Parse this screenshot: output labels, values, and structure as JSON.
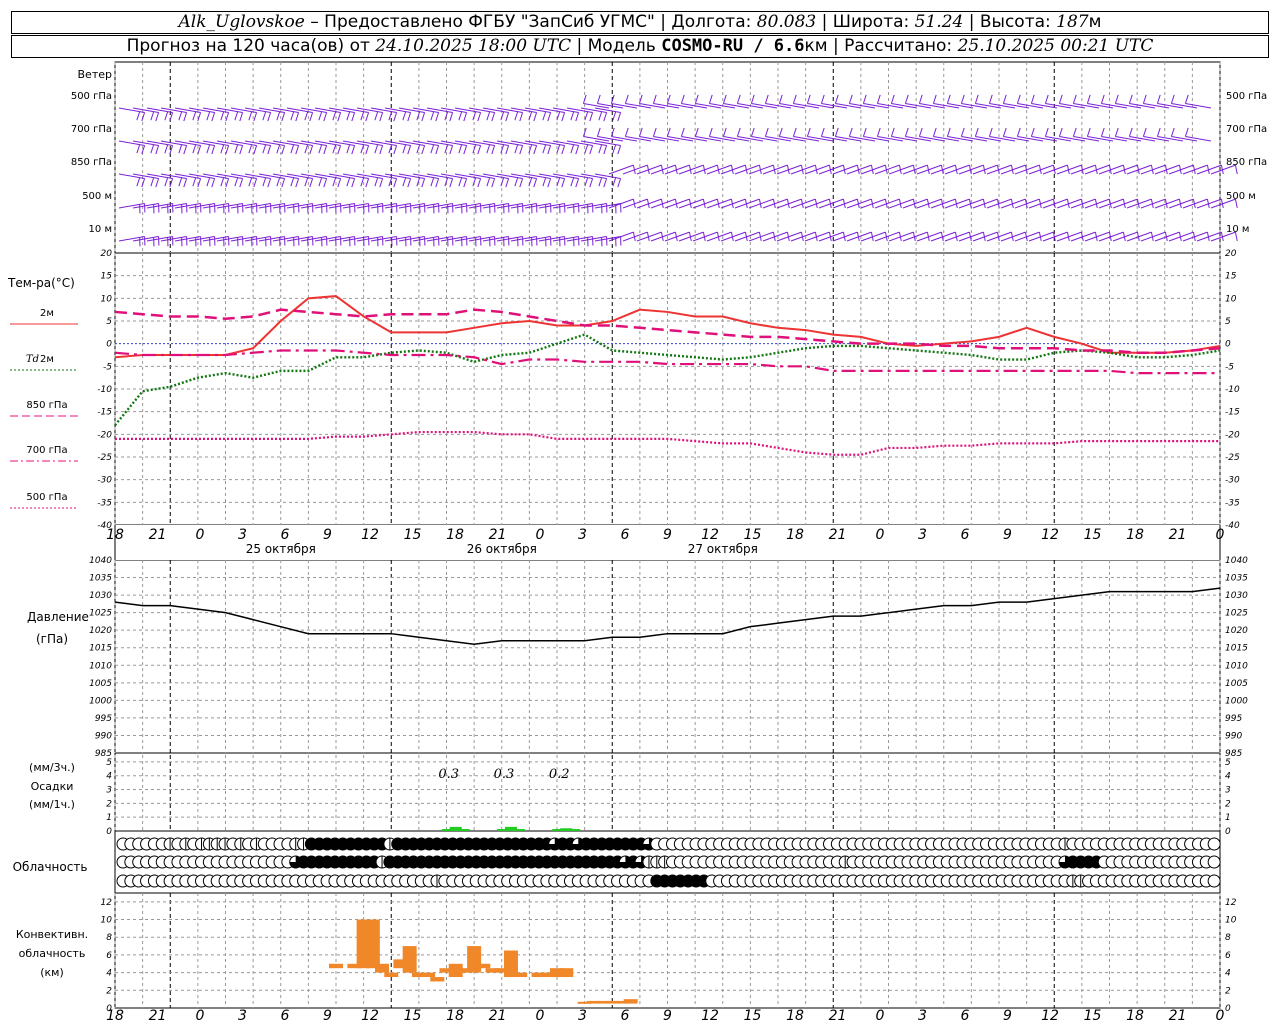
{
  "header": {
    "station": "Alk_Uglovskoe",
    "dash": " – ",
    "provider": "Предоставлено ФГБУ \"ЗапСиб УГМС\"",
    "sep": " | ",
    "lon_label": "Долгота: ",
    "lon_value": "80.083",
    "lat_label": "Широта: ",
    "lat_value": "51.24",
    "alt_label": "Высота: ",
    "alt_value": "187",
    "alt_unit": "м",
    "forecast_prefix": "Прогноз на 120 часа(ов) от ",
    "forecast_time": "24.10.2025 18:00 UTC",
    "model_label": " | Модель ",
    "model_name": "COSMO-RU / 6.6",
    "model_unit": "км",
    "calc_label": " | Рассчитано: ",
    "calc_time": "25.10.2025 00:21 UTC"
  },
  "x_axis": {
    "hour_labels": [
      "18",
      "21",
      "0",
      "3",
      "6",
      "9",
      "12",
      "15",
      "18",
      "21",
      "0",
      "3",
      "6",
      "9",
      "12",
      "15",
      "18",
      "21",
      "0",
      "3",
      "6",
      "9",
      "12",
      "15",
      "18",
      "21",
      "0"
    ],
    "day_labels": [
      "25 октября",
      "26 октября",
      "27 октября"
    ]
  },
  "wind_panel": {
    "title": "Ветер",
    "levels": [
      "500 гПа",
      "700 гПа",
      "850 гПа",
      "500 м",
      "10  м"
    ],
    "color": "#7b1fd6"
  },
  "temp_panel": {
    "title": "Тем-ра(°С)",
    "y_ticks": [
      "20",
      "15",
      "10",
      "5",
      "0",
      "-5",
      "-10",
      "-15",
      "-20",
      "-25",
      "-30",
      "-35",
      "-40"
    ],
    "legend": [
      {
        "label": "2м",
        "color": "#ee3333",
        "style": "solid"
      },
      {
        "label_a": "Td",
        "label_b": " 2м",
        "color": "#117711",
        "style": "dotted"
      },
      {
        "label": "850 гПа",
        "color": "#e0107a",
        "style": "dashed"
      },
      {
        "label": "700 гПа",
        "color": "#e0107a",
        "style": "dashdot"
      },
      {
        "label": "500 гПа",
        "color": "#e0107a",
        "style": "dotted"
      }
    ]
  },
  "pressure_panel": {
    "title_a": "Давление",
    "title_b": "(гПа)",
    "y_ticks": [
      "1040",
      "1035",
      "1030",
      "1025",
      "1020",
      "1015",
      "1010",
      "1005",
      "1000",
      "995",
      "990",
      "985"
    ]
  },
  "precip_panel": {
    "title_a": "(мм/3ч.)",
    "title_b": "Осадки",
    "title_c": "(мм/1ч.)",
    "y_ticks": [
      "5",
      "4",
      "3",
      "2",
      "1",
      "0"
    ],
    "annotations": [
      "0.3",
      "0.3",
      "0.2"
    ]
  },
  "cloud_panel": {
    "title": "Облачность"
  },
  "conv_panel": {
    "title_a": "Конвективн.",
    "title_b": "облачность",
    "title_c": "(км)",
    "y_ticks": [
      "12",
      "10",
      "8",
      "6",
      "4",
      "2",
      "0"
    ]
  },
  "chart_data": [
    {
      "type": "line",
      "title": "Тем-ра(°С)",
      "ylim": [
        -40,
        20
      ],
      "x": [
        0,
        3,
        6,
        9,
        12,
        15,
        18,
        21,
        24,
        27,
        30,
        33,
        36,
        39,
        42,
        45,
        48,
        51,
        54,
        57,
        60,
        63,
        66,
        69,
        72,
        75,
        78,
        81,
        84,
        87,
        90,
        93,
        96,
        99,
        102,
        105,
        108,
        111,
        114,
        117,
        120
      ],
      "series": [
        {
          "name": "2м",
          "values": [
            -3,
            -2.5,
            -2.5,
            -2.5,
            -2.5,
            -1,
            5,
            10,
            10.5,
            6,
            2.5,
            2.5,
            2.5,
            3.5,
            4.5,
            5,
            4,
            4,
            5,
            7.5,
            7,
            6,
            6,
            4.5,
            3.5,
            3,
            2,
            1.5,
            0,
            -0.5,
            0,
            0.5,
            1.5,
            3.5,
            1.5,
            0,
            -2,
            -2,
            -2,
            -1.5,
            -0.5
          ]
        },
        {
          "name": "Td 2м",
          "values": [
            -18,
            -10.5,
            -9.5,
            -7.5,
            -6.5,
            -7.5,
            -6,
            -6,
            -3,
            -3,
            -2,
            -1.5,
            -2,
            -4,
            -2.5,
            -2,
            0,
            2,
            -1.5,
            -2,
            -2.5,
            -3,
            -3.5,
            -3,
            -2,
            -1,
            -0.5,
            -0.5,
            -1,
            -1.5,
            -2,
            -2.5,
            -3.5,
            -3.5,
            -2,
            -1.5,
            -2,
            -3,
            -3,
            -2.5,
            -1.5
          ]
        },
        {
          "name": "850 гПа",
          "values": [
            7,
            6.5,
            6,
            6,
            5.5,
            6,
            7.5,
            7,
            6.5,
            6,
            6.5,
            6.5,
            6.5,
            7.5,
            7,
            6,
            5,
            4,
            4,
            3.5,
            3,
            2.5,
            2,
            1.5,
            1.5,
            1,
            0.5,
            0,
            0,
            0,
            -0.5,
            -0.5,
            -1,
            -1,
            -1,
            -1.5,
            -1.5,
            -2,
            -2,
            -1.5,
            -1
          ]
        },
        {
          "name": "700 гПа",
          "values": [
            -2,
            -2.5,
            -2.5,
            -2.5,
            -2.5,
            -2,
            -1.5,
            -1.5,
            -1.5,
            -2,
            -2.5,
            -2.5,
            -2.5,
            -3,
            -4.5,
            -3.5,
            -3.5,
            -4,
            -4,
            -4,
            -4.5,
            -4.5,
            -4.5,
            -4.5,
            -5,
            -5,
            -6,
            -6,
            -6,
            -6,
            -6,
            -6,
            -6,
            -6,
            -6,
            -6,
            -6,
            -6.5,
            -6.5,
            -6.5,
            -6.5
          ]
        },
        {
          "name": "500 гПа",
          "values": [
            -21,
            -21,
            -21,
            -21,
            -21,
            -21,
            -21,
            -21,
            -20.5,
            -20.5,
            -20,
            -19.5,
            -19.5,
            -19.5,
            -20,
            -20,
            -21,
            -21,
            -21,
            -21,
            -21,
            -21.5,
            -22,
            -22,
            -23,
            -24,
            -24.5,
            -24.5,
            -23,
            -23,
            -22.5,
            -22.5,
            -22,
            -22,
            -22,
            -21.5,
            -21.5,
            -21.5,
            -21.5,
            -21.5,
            -21.5
          ]
        }
      ]
    },
    {
      "type": "line",
      "title": "Давление (гПа)",
      "ylim": [
        985,
        1040
      ],
      "x": [
        0,
        3,
        6,
        9,
        12,
        15,
        18,
        21,
        24,
        27,
        30,
        33,
        36,
        39,
        42,
        45,
        48,
        51,
        54,
        57,
        60,
        63,
        66,
        69,
        72,
        75,
        78,
        81,
        84,
        87,
        90,
        93,
        96,
        99,
        102,
        105,
        108,
        111,
        114,
        117,
        120
      ],
      "series": [
        {
          "name": "Давление",
          "values": [
            1028,
            1027,
            1027,
            1026,
            1025,
            1023,
            1021,
            1019,
            1019,
            1019,
            1019,
            1018,
            1017,
            1016,
            1017,
            1017,
            1017,
            1017,
            1018,
            1018,
            1019,
            1019,
            1019,
            1021,
            1022,
            1023,
            1024,
            1024,
            1025,
            1026,
            1027,
            1027,
            1028,
            1028,
            1029,
            1030,
            1031,
            1031,
            1031,
            1031,
            1032
          ]
        }
      ]
    },
    {
      "type": "bar",
      "title": "Осадки",
      "ylim": [
        0,
        5
      ],
      "x": [
        37,
        43,
        49
      ],
      "values": [
        0.3,
        0.3,
        0.2
      ],
      "values_1h": [
        0.4,
        0.4,
        0.3
      ]
    },
    {
      "type": "bar",
      "title": "Конвективн. облачность (км)",
      "ylim": [
        0,
        13
      ],
      "bars": [
        {
          "x": 24,
          "base": 4.5,
          "top": 5
        },
        {
          "x": 26,
          "base": 4.5,
          "top": 5
        },
        {
          "x": 27,
          "base": 4.5,
          "top": 10
        },
        {
          "x": 28,
          "base": 4.5,
          "top": 10
        },
        {
          "x": 29,
          "base": 4,
          "top": 5
        },
        {
          "x": 30,
          "base": 3.5,
          "top": 4
        },
        {
          "x": 31,
          "base": 4.5,
          "top": 5.5
        },
        {
          "x": 32,
          "base": 4,
          "top": 7
        },
        {
          "x": 33,
          "base": 3.5,
          "top": 4
        },
        {
          "x": 34,
          "base": 3.5,
          "top": 4
        },
        {
          "x": 35,
          "base": 3,
          "top": 3.5
        },
        {
          "x": 36,
          "base": 4,
          "top": 4.5
        },
        {
          "x": 37,
          "base": 3.5,
          "top": 5
        },
        {
          "x": 38,
          "base": 4,
          "top": 4.5
        },
        {
          "x": 39,
          "base": 4,
          "top": 7
        },
        {
          "x": 40,
          "base": 4.5,
          "top": 5
        },
        {
          "x": 41,
          "base": 4,
          "top": 4.5
        },
        {
          "x": 42,
          "base": 4,
          "top": 4.5
        },
        {
          "x": 43,
          "base": 3.5,
          "top": 6.5
        },
        {
          "x": 44,
          "base": 3.5,
          "top": 4
        },
        {
          "x": 46,
          "base": 3.5,
          "top": 4
        },
        {
          "x": 47,
          "base": 3.5,
          "top": 4
        },
        {
          "x": 48,
          "base": 3.5,
          "top": 4.5
        },
        {
          "x": 49,
          "base": 3.5,
          "top": 4.5
        },
        {
          "x": 51,
          "base": 0.5,
          "top": 0.7
        },
        {
          "x": 52,
          "base": 0.5,
          "top": 0.8
        },
        {
          "x": 53,
          "base": 0.5,
          "top": 0.8
        },
        {
          "x": 54,
          "base": 0.5,
          "top": 0.8
        },
        {
          "x": 55,
          "base": 0.5,
          "top": 0.8
        },
        {
          "x": 56,
          "base": 0.5,
          "top": 1
        }
      ]
    },
    {
      "type": "table",
      "title": "Облачность",
      "rows": [
        [
          0,
          0,
          0,
          0,
          0,
          0,
          2,
          0,
          2,
          0,
          2,
          2,
          2,
          2,
          0,
          2,
          0,
          2,
          0,
          0,
          0,
          0,
          2,
          2,
          4,
          4,
          4,
          4,
          4,
          4,
          4,
          4,
          4,
          4,
          2,
          4,
          4,
          4,
          4,
          4,
          4,
          4,
          4,
          4,
          4,
          4,
          4,
          4,
          4,
          4,
          4,
          4,
          4,
          4,
          4,
          3,
          4,
          4,
          3,
          4,
          4,
          4,
          4,
          4,
          4,
          4,
          4,
          3,
          0,
          0,
          0,
          0,
          0,
          0,
          0,
          0,
          0,
          0,
          0,
          0,
          0,
          0,
          0,
          0,
          0,
          0,
          0,
          0,
          0,
          0,
          0,
          0,
          0,
          0,
          0,
          0,
          0,
          0,
          0,
          0,
          0,
          0,
          0,
          0,
          0,
          0,
          0,
          0,
          0,
          0,
          0,
          0,
          0,
          0,
          0,
          0,
          0,
          0,
          0,
          0,
          2,
          0,
          0,
          0,
          0,
          0,
          0,
          0,
          0,
          0,
          0,
          0,
          0,
          0,
          0,
          0,
          0,
          0,
          0,
          0
        ],
        [
          0,
          0,
          0,
          0,
          0,
          0,
          0,
          0,
          0,
          0,
          0,
          0,
          0,
          0,
          0,
          0,
          0,
          0,
          0,
          0,
          0,
          0,
          3,
          4,
          4,
          4,
          4,
          4,
          4,
          4,
          4,
          4,
          4,
          2,
          4,
          4,
          4,
          4,
          4,
          4,
          4,
          4,
          4,
          4,
          4,
          4,
          4,
          4,
          4,
          4,
          4,
          4,
          4,
          4,
          4,
          4,
          4,
          4,
          4,
          4,
          4,
          4,
          4,
          4,
          3,
          4,
          3,
          2,
          2,
          2,
          0,
          0,
          0,
          0,
          0,
          0,
          0,
          0,
          0,
          0,
          0,
          0,
          0,
          0,
          0,
          0,
          0,
          0,
          0,
          0,
          0,
          0,
          2,
          0,
          0,
          0,
          0,
          0,
          0,
          0,
          0,
          0,
          0,
          0,
          0,
          0,
          0,
          0,
          0,
          0,
          0,
          0,
          0,
          0,
          0,
          0,
          0,
          0,
          0,
          0,
          3,
          4,
          4,
          4,
          4,
          0,
          0,
          0,
          0,
          0,
          0,
          0,
          0,
          0,
          0,
          0,
          0,
          0,
          0,
          0
        ],
        [
          0,
          0,
          0,
          0,
          0,
          0,
          0,
          0,
          0,
          0,
          0,
          0,
          0,
          0,
          0,
          0,
          0,
          0,
          0,
          0,
          0,
          0,
          0,
          0,
          0,
          0,
          0,
          0,
          0,
          0,
          0,
          0,
          0,
          0,
          0,
          0,
          0,
          0,
          0,
          0,
          2,
          0,
          0,
          0,
          0,
          0,
          0,
          0,
          0,
          0,
          0,
          0,
          0,
          0,
          0,
          0,
          0,
          0,
          0,
          0,
          0,
          0,
          0,
          0,
          0,
          0,
          0,
          0,
          4,
          4,
          4,
          4,
          4,
          4,
          4,
          0,
          0,
          0,
          0,
          0,
          0,
          0,
          0,
          0,
          0,
          0,
          0,
          0,
          0,
          0,
          0,
          0,
          0,
          0,
          0,
          0,
          0,
          0,
          0,
          0,
          0,
          0,
          0,
          0,
          0,
          0,
          0,
          0,
          0,
          0,
          0,
          0,
          0,
          0,
          0,
          0,
          0,
          0,
          0,
          0,
          0,
          2,
          2,
          0,
          0,
          0,
          0,
          0,
          0,
          0,
          0,
          0,
          0,
          0,
          0,
          0,
          0,
          0,
          0,
          0
        ]
      ]
    }
  ]
}
